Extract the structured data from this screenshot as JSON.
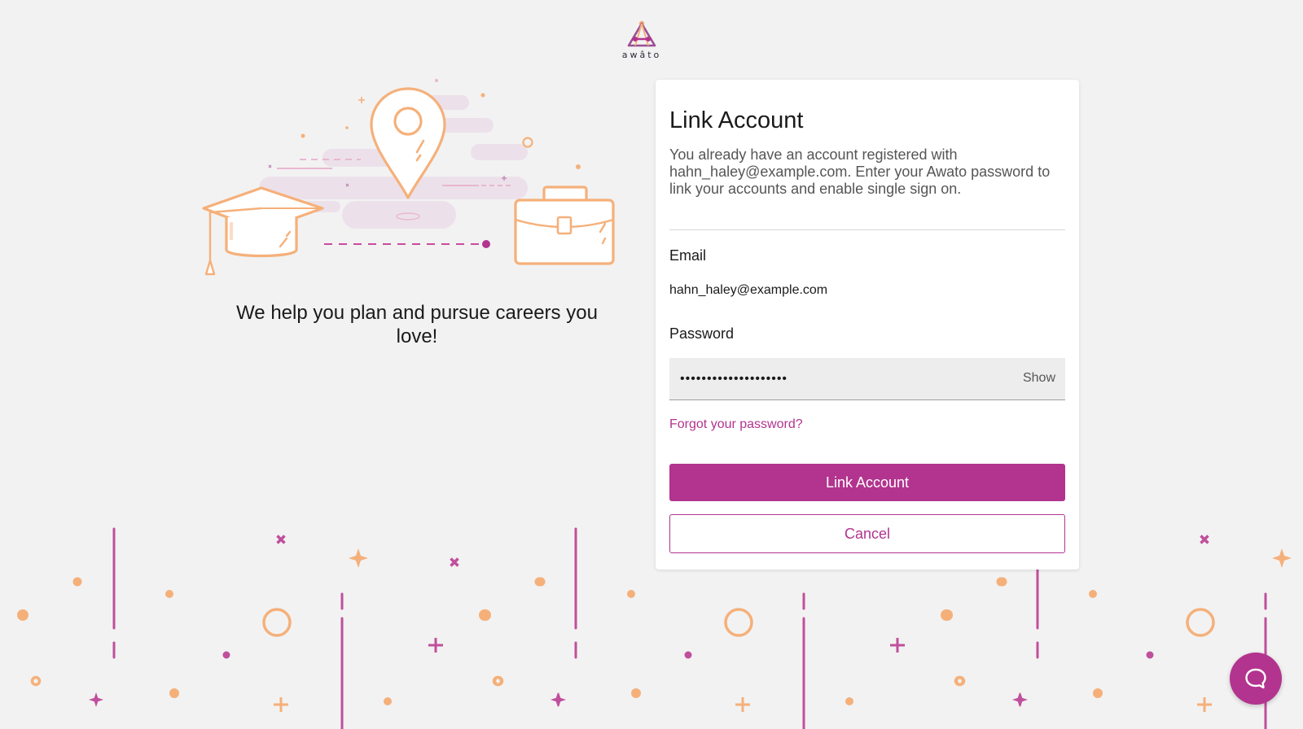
{
  "brand": {
    "name": "awâto",
    "accent_color": "#b2348e",
    "illustration_color": "#f5b07a"
  },
  "hero": {
    "tagline": "We help you plan and pursue careers you love!"
  },
  "link_account": {
    "title": "Link Account",
    "description": "You already have an account registered with hahn_haley@example.com. Enter your Awato password to link your accounts and enable single sign on.",
    "email_label": "Email",
    "email_value": "hahn_haley@example.com",
    "password_label": "Password",
    "password_value": "••••••••••••••••••••",
    "show_label": "Show",
    "forgot_link": "Forgot your password?",
    "submit_label": "Link Account",
    "cancel_label": "Cancel"
  },
  "chat": {
    "icon": "chat-bubble-icon"
  }
}
